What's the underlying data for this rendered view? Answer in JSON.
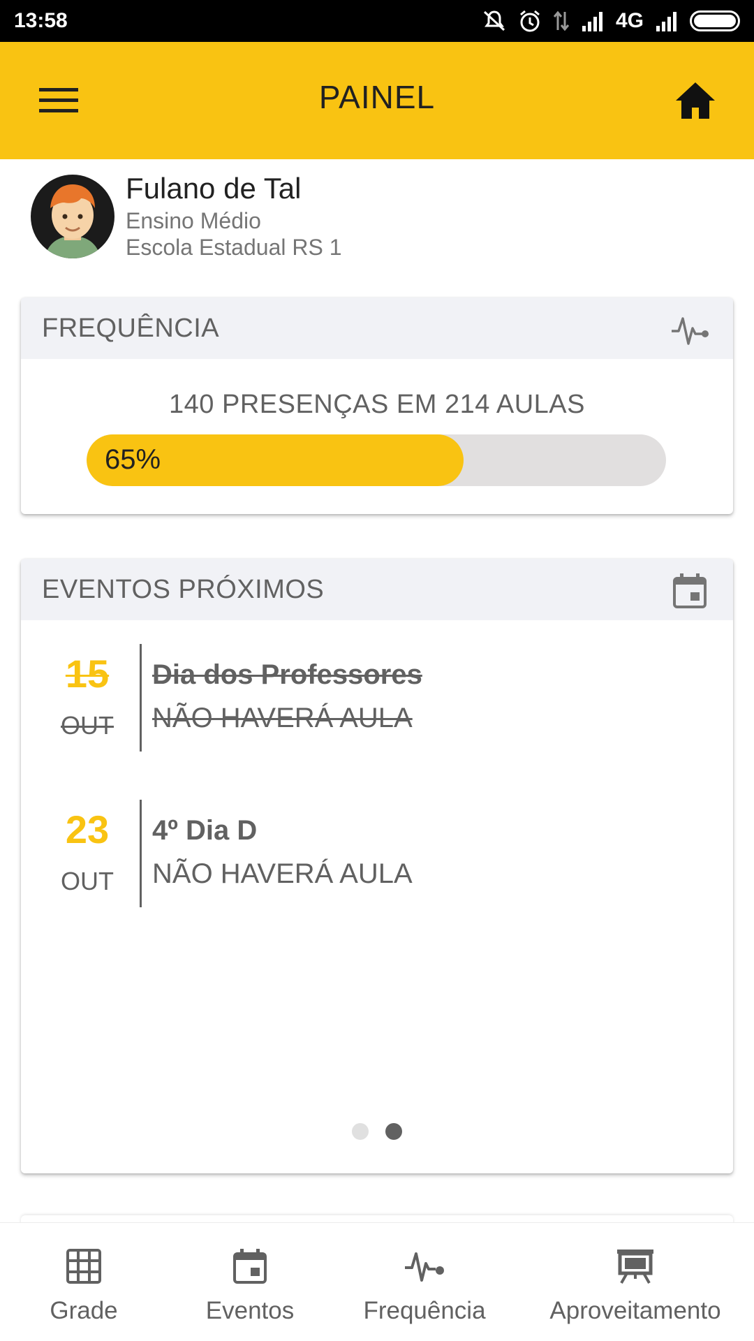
{
  "status_bar": {
    "time": "13:58",
    "network": "4G",
    "icons": [
      "mute-icon",
      "alarm-icon",
      "data-arrows-icon",
      "signal-icon",
      "signal-icon",
      "battery-icon"
    ]
  },
  "app_bar": {
    "title": "PAINEL",
    "left_icon": "menu-icon",
    "right_icon": "home-icon",
    "color": "#F9C312"
  },
  "profile": {
    "name": "Fulano de Tal",
    "level": "Ensino Médio",
    "school": "Escola Estadual RS 1"
  },
  "frequency_card": {
    "title": "FREQUÊNCIA",
    "icon": "pulse-icon",
    "summary": "140 PRESENÇAS EM 214 AULAS",
    "progress_label": "65%",
    "progress_fraction": 0.65
  },
  "events_card": {
    "title": "EVENTOS PRÓXIMOS",
    "icon": "calendar-icon",
    "events": [
      {
        "day": "15",
        "month": "OUT",
        "title": "Dia dos Professores",
        "subtitle": "NÃO HAVERÁ AULA",
        "struck": true
      },
      {
        "day": "23",
        "month": "OUT",
        "title": "4º Dia D",
        "subtitle": "NÃO HAVERÁ AULA",
        "struck": false
      }
    ],
    "pager": {
      "pages": 2,
      "active": 2
    }
  },
  "bottom_nav": {
    "items": [
      {
        "label": "Grade",
        "icon": "grid-icon"
      },
      {
        "label": "Eventos",
        "icon": "calendar-icon"
      },
      {
        "label": "Frequência",
        "icon": "pulse-icon"
      },
      {
        "label": "Aproveitamento",
        "icon": "presentation-icon"
      }
    ]
  },
  "colors": {
    "accent": "#F9C312",
    "text_secondary": "#616161",
    "card_header_bg": "#F1F2F6",
    "progress_track": "#E1DFDF"
  }
}
